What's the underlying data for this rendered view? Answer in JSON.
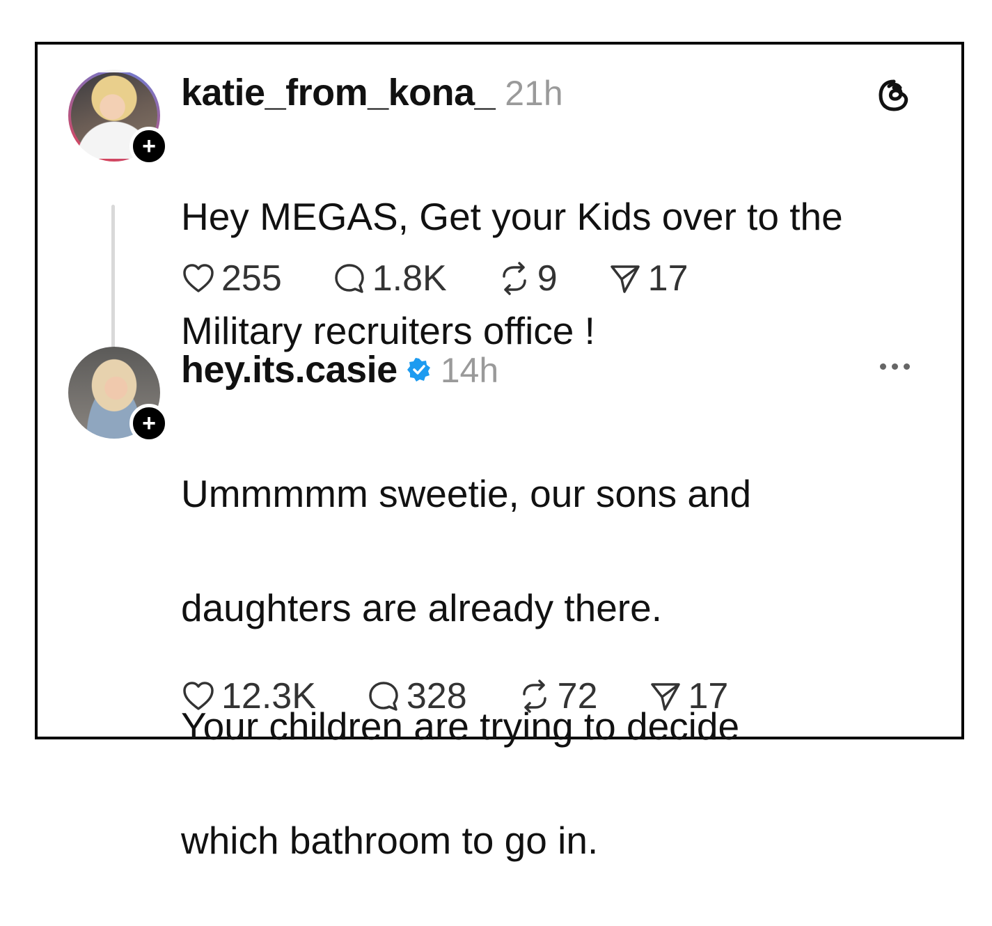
{
  "posts": [
    {
      "username": "katie_from_kona_",
      "verified": false,
      "time": "21h",
      "corner_icon": "threads-logo-icon",
      "text_lines": [
        "Hey MEGAS, Get your Kids over to the",
        "Military recruiters office !"
      ],
      "likes": "255",
      "replies": "1.8K",
      "reposts": "9",
      "shares": "17"
    },
    {
      "username": "hey.its.casie",
      "verified": true,
      "time": "14h",
      "corner_icon": "more-options-icon",
      "paragraphs": [
        [
          "Ummmmm sweetie, our sons and",
          "daughters are already there."
        ],
        [
          "Your children are trying to decide",
          "which bathroom to go in."
        ]
      ],
      "likes": "12.3K",
      "replies": "328",
      "reposts": "72",
      "shares": "17"
    }
  ],
  "colors": {
    "text": "#111111",
    "muted": "#9a9a9a",
    "verified": "#1d9bf0",
    "border": "#000000"
  }
}
